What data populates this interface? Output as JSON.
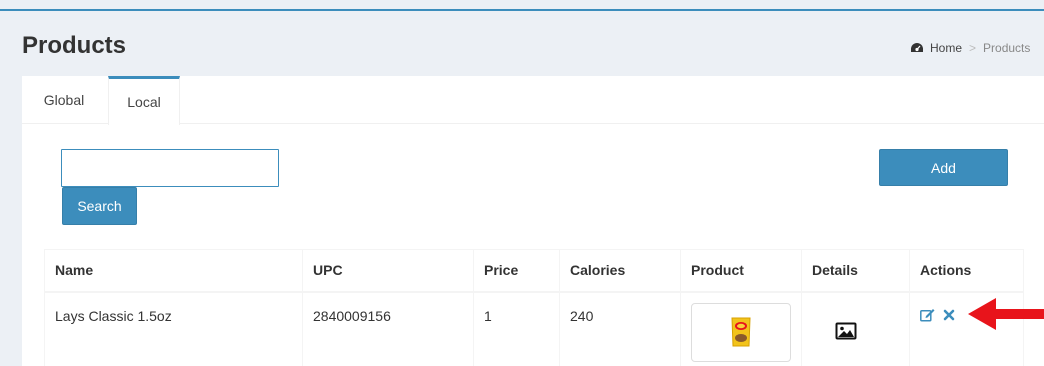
{
  "header": {
    "title": "Products",
    "breadcrumb": {
      "home_label": "Home",
      "separator": ">",
      "current": "Products"
    }
  },
  "tabs": [
    {
      "label": "Global",
      "active": false
    },
    {
      "label": "Local",
      "active": true
    }
  ],
  "search": {
    "value": "",
    "placeholder": "",
    "button_label": "Search"
  },
  "add_button_label": "Add",
  "table": {
    "columns": [
      "Name",
      "UPC",
      "Price",
      "Calories",
      "Product",
      "Details",
      "Actions"
    ],
    "rows": [
      {
        "name": "Lays Classic 1.5oz",
        "upc": "2840009156",
        "price": "1",
        "calories": "240",
        "product_image": "chip-bag-image",
        "details_icon": "image-icon",
        "actions": [
          "edit-icon",
          "delete-icon"
        ]
      }
    ]
  },
  "colors": {
    "accent": "#3c8dbc",
    "background": "#ecf0f5",
    "annotation_arrow": "#e8141b"
  }
}
